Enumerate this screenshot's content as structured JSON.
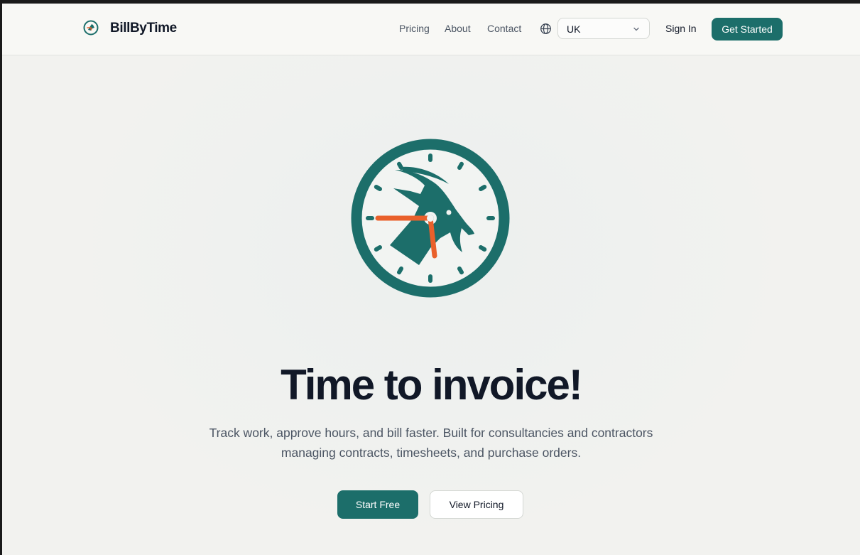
{
  "brand": {
    "name": "BillByTime",
    "logo_icon": "goat-clock-icon"
  },
  "nav": {
    "links": [
      {
        "label": "Pricing"
      },
      {
        "label": "About"
      },
      {
        "label": "Contact"
      }
    ],
    "language_icon": "globe-icon",
    "region_select": {
      "value": "UK",
      "icon": "chevron-down-icon"
    },
    "sign_in": "Sign In",
    "get_started": "Get Started"
  },
  "hero": {
    "title": "Time to invoice!",
    "subtitle_line1": "Track work, approve hours, and bill faster. Built for consultancies and contractors",
    "subtitle_line2": "managing contracts, timesheets, and purchase orders.",
    "primary_cta": "Start Free",
    "secondary_cta": "View Pricing"
  },
  "colors": {
    "accent": "#1c6e6a",
    "clock_hands": "#e9602b",
    "heading": "#111827",
    "body_text": "#4b5563"
  }
}
